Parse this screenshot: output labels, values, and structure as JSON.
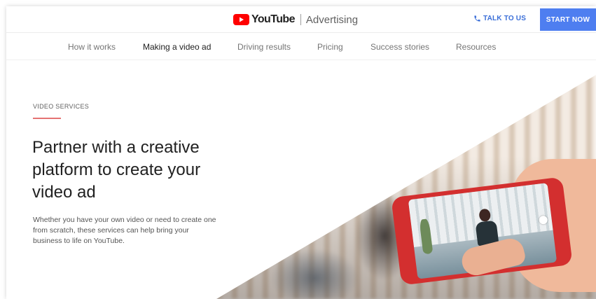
{
  "header": {
    "logo_wordmark": "YouTube",
    "product": "Advertising",
    "talk_label": "TALK TO US",
    "start_label": "START NOW"
  },
  "nav": {
    "items": [
      {
        "label": "How it works",
        "active": false
      },
      {
        "label": "Making a video ad",
        "active": true
      },
      {
        "label": "Driving results",
        "active": false
      },
      {
        "label": "Pricing",
        "active": false
      },
      {
        "label": "Success stories",
        "active": false
      },
      {
        "label": "Resources",
        "active": false
      }
    ]
  },
  "hero": {
    "eyebrow": "VIDEO SERVICES",
    "headline_lines": [
      "Partner with a creative",
      "platform to create your",
      "video ad"
    ],
    "body_lines": [
      "Whether you have your own video or need to create one",
      "from scratch, these services can help bring your",
      "business to life on YouTube."
    ]
  },
  "colors": {
    "brand_red": "#ff0000",
    "cta_blue": "#4e7ef0",
    "link_blue": "#3b6fd8",
    "accent_rule": "#e57373"
  },
  "icons": {
    "logo": "youtube-play-icon",
    "phone": "phone-icon"
  }
}
